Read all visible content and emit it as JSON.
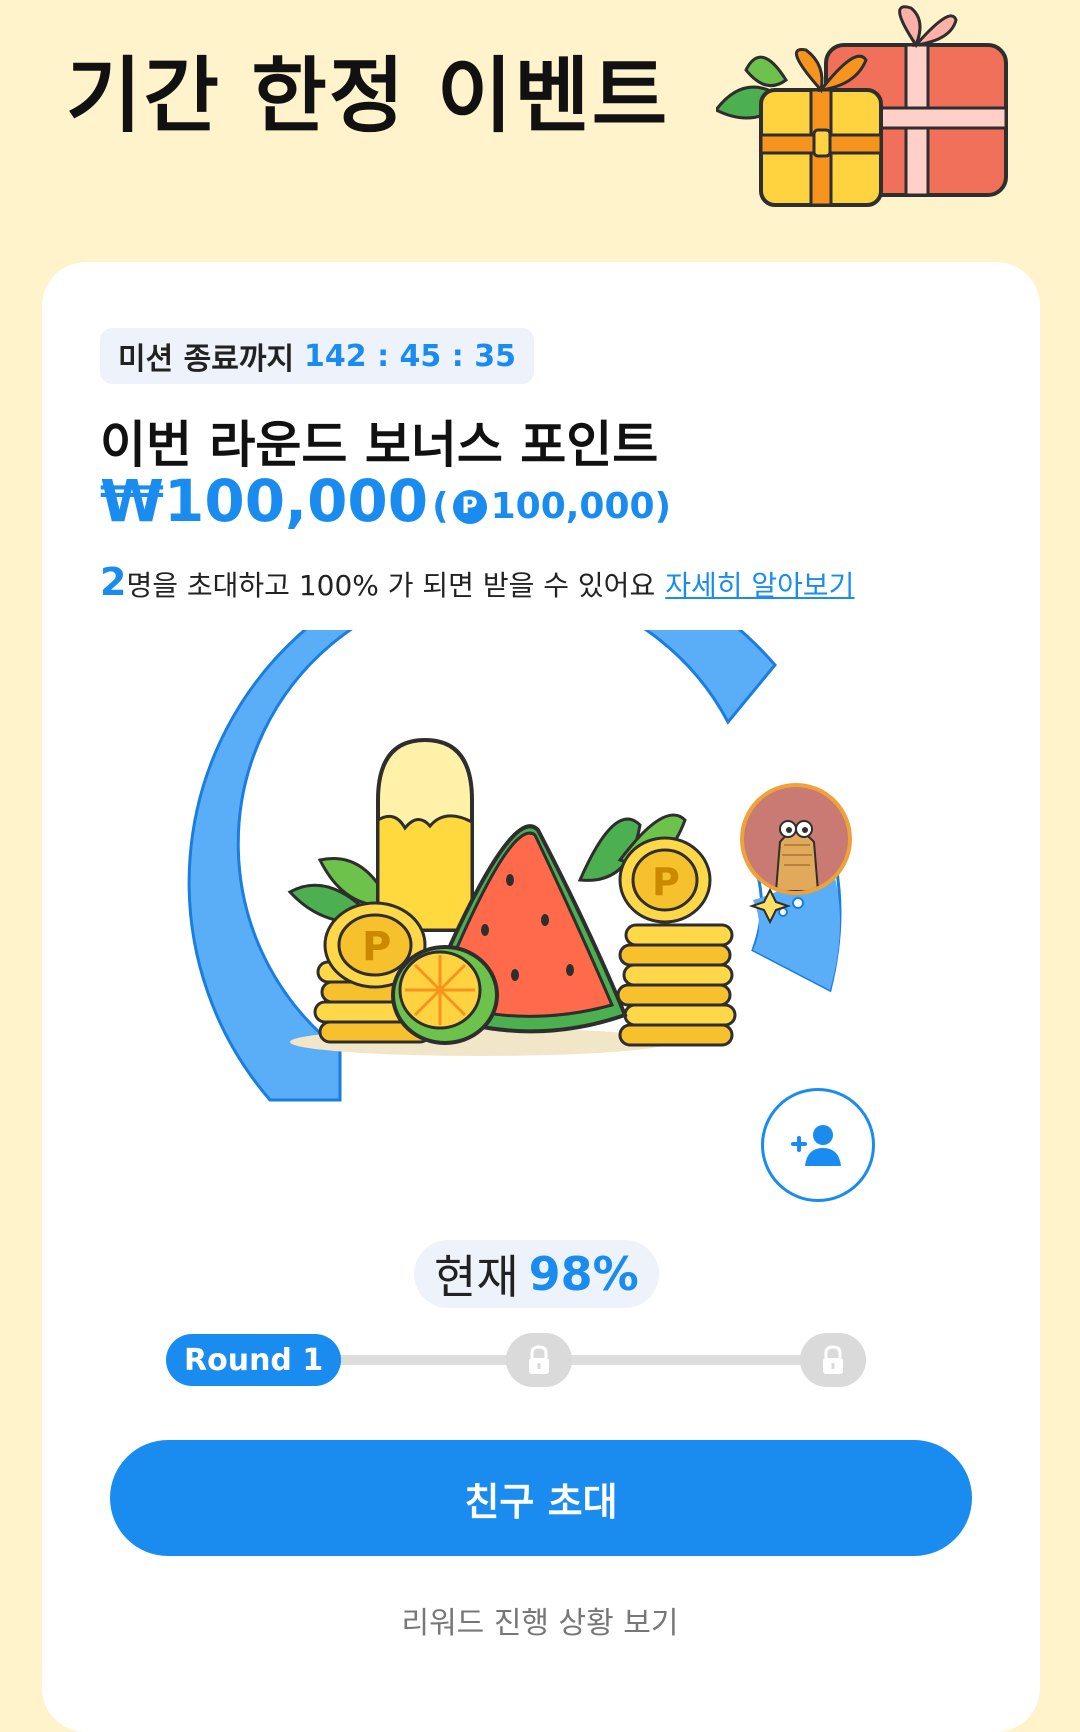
{
  "header": {
    "title": "기간 한정 이벤트"
  },
  "card": {
    "timer": {
      "label": "미션 종료까지",
      "value": "142 : 45 : 35"
    },
    "heading": "이번 라운드 보너스 포인트",
    "bonus": {
      "amount": "₩100,000",
      "points_open": "(",
      "points_badge": "P",
      "points_value": "100,000",
      "points_close": ")"
    },
    "invite": {
      "count": "2",
      "text": "명을 초대하고 100% 가 되면 받을 수 있어요",
      "link": "자세히 알아보기"
    },
    "progress": {
      "label": "현재",
      "value": "98%",
      "fraction": 0.98
    },
    "rounds": {
      "current_label": "Round 1",
      "locked_count": 2
    },
    "cta_label": "친구 초대",
    "reward_link": "리워드 진행 상황 보기"
  },
  "colors": {
    "accent": "#1a8cf0",
    "gauge_light": "#5aaef7",
    "background": "#fff3cc"
  }
}
